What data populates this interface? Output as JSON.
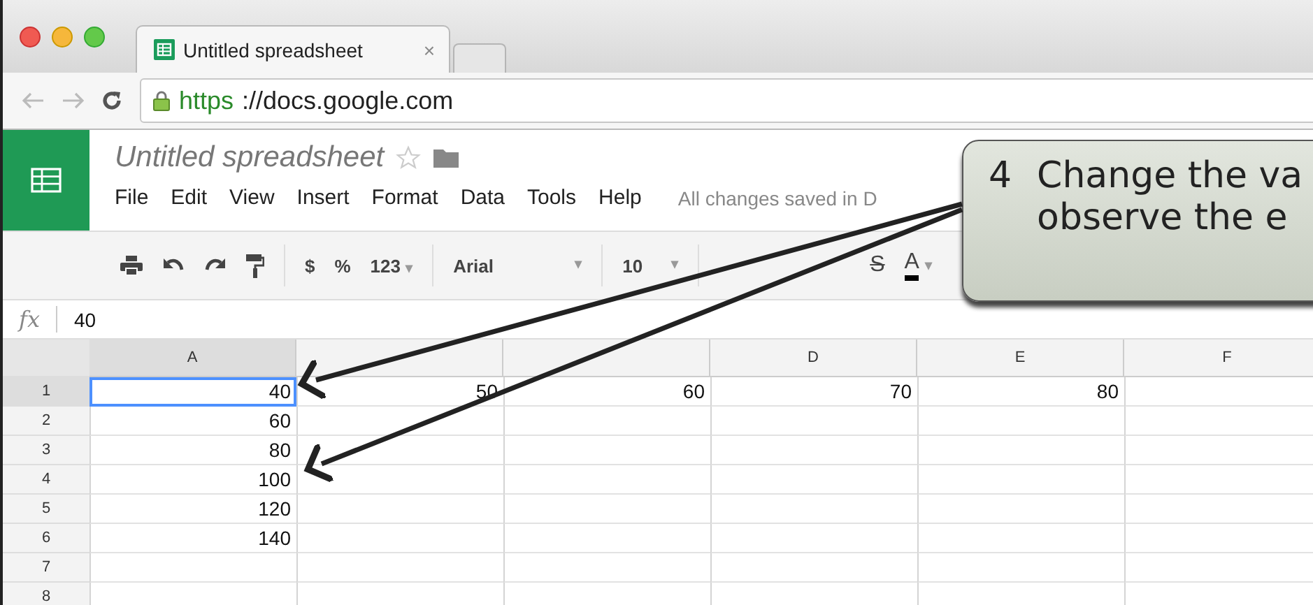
{
  "browser": {
    "tab": {
      "title": "Untitled spreadsheet",
      "close": "×"
    },
    "url": {
      "scheme": "https",
      "rest": "://docs.google.com"
    }
  },
  "sheet": {
    "title": "Untitled spreadsheet",
    "menus": [
      "File",
      "Edit",
      "View",
      "Insert",
      "Format",
      "Data",
      "Tools",
      "Help"
    ],
    "save_status": "All changes saved in D"
  },
  "toolbar": {
    "currency": "$",
    "percent": "%",
    "number_format": "123",
    "number_format_caret": "▾",
    "font": "Arial",
    "font_caret": "▾",
    "font_size": "10",
    "font_size_caret": "▾",
    "format_buttons": [
      {
        "kind": "strike",
        "label": "S"
      },
      {
        "kind": "color",
        "label": "A",
        "caret": "▾"
      }
    ]
  },
  "formula_bar": {
    "label": "fx",
    "value": "40"
  },
  "grid": {
    "columns": [
      {
        "label": "A",
        "selected": true
      },
      {
        "selected": false
      },
      {
        "selected": false
      },
      {
        "label": "D",
        "selected": false
      },
      {
        "label": "E",
        "selected": false
      },
      {
        "label": "F",
        "selected": false
      }
    ],
    "rows": [
      {
        "number": "1",
        "selected": true,
        "cells": [
          "40",
          "50",
          "60",
          "70",
          "80",
          ""
        ]
      },
      {
        "number": "2",
        "selected": false,
        "cells": [
          "60",
          "",
          "",
          "",
          "",
          ""
        ]
      },
      {
        "number": "3",
        "selected": false,
        "cells": [
          "80",
          "",
          "",
          "",
          "",
          ""
        ]
      },
      {
        "number": "4",
        "selected": false,
        "cells": [
          "100",
          "",
          "",
          "",
          "",
          ""
        ]
      },
      {
        "number": "5",
        "selected": false,
        "cells": [
          "120",
          "",
          "",
          "",
          "",
          ""
        ]
      },
      {
        "number": "6",
        "selected": false,
        "cells": [
          "140",
          "",
          "",
          "",
          "",
          ""
        ]
      },
      {
        "number": "7",
        "selected": false,
        "cells": [
          "",
          "",
          "",
          "",
          "",
          ""
        ]
      },
      {
        "number": "8",
        "selected": false,
        "cells": [
          "",
          "",
          "",
          "",
          "",
          ""
        ]
      }
    ]
  },
  "callout": {
    "step": "4",
    "lines": [
      "Change the va",
      "observe the e"
    ]
  }
}
